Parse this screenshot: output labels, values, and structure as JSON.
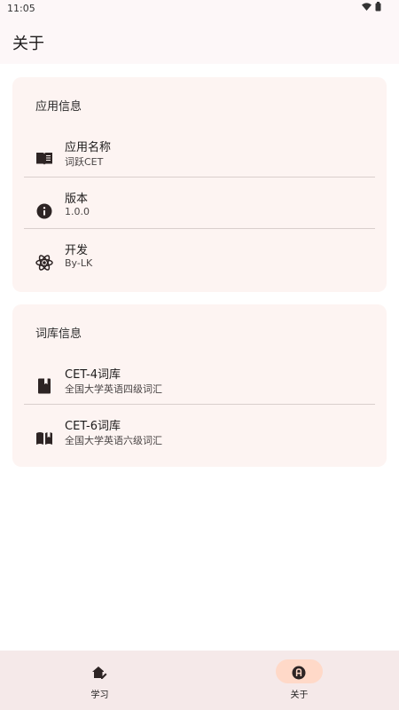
{
  "status": {
    "time": "11:05"
  },
  "header": {
    "title": "关于"
  },
  "app_info": {
    "title": "应用信息",
    "items": [
      {
        "icon": "book-open-icon",
        "title": "应用名称",
        "subtitle": "词跃CET"
      },
      {
        "icon": "info-icon",
        "title": "版本",
        "subtitle": "1.0.0"
      },
      {
        "icon": "atom-icon",
        "title": "开发",
        "subtitle": "By-LK"
      }
    ]
  },
  "library_info": {
    "title": "词库信息",
    "items": [
      {
        "icon": "book-closed-icon",
        "title": "CET-4词库",
        "subtitle": "全国大学英语四级词汇"
      },
      {
        "icon": "book-open-reader-icon",
        "title": "CET-6词库",
        "subtitle": "全国大学英语六级词汇"
      }
    ]
  },
  "bottom_nav": {
    "items": [
      {
        "label": "学习",
        "icon": "home-edit-icon",
        "selected": false
      },
      {
        "label": "关于",
        "icon": "about-badge-icon",
        "selected": true
      }
    ]
  },
  "colors": {
    "card_bg": "#fdf4f2",
    "nav_bg": "#f5e9e9",
    "nav_pill": "#ffd9c8",
    "icon": "#2d2424"
  }
}
